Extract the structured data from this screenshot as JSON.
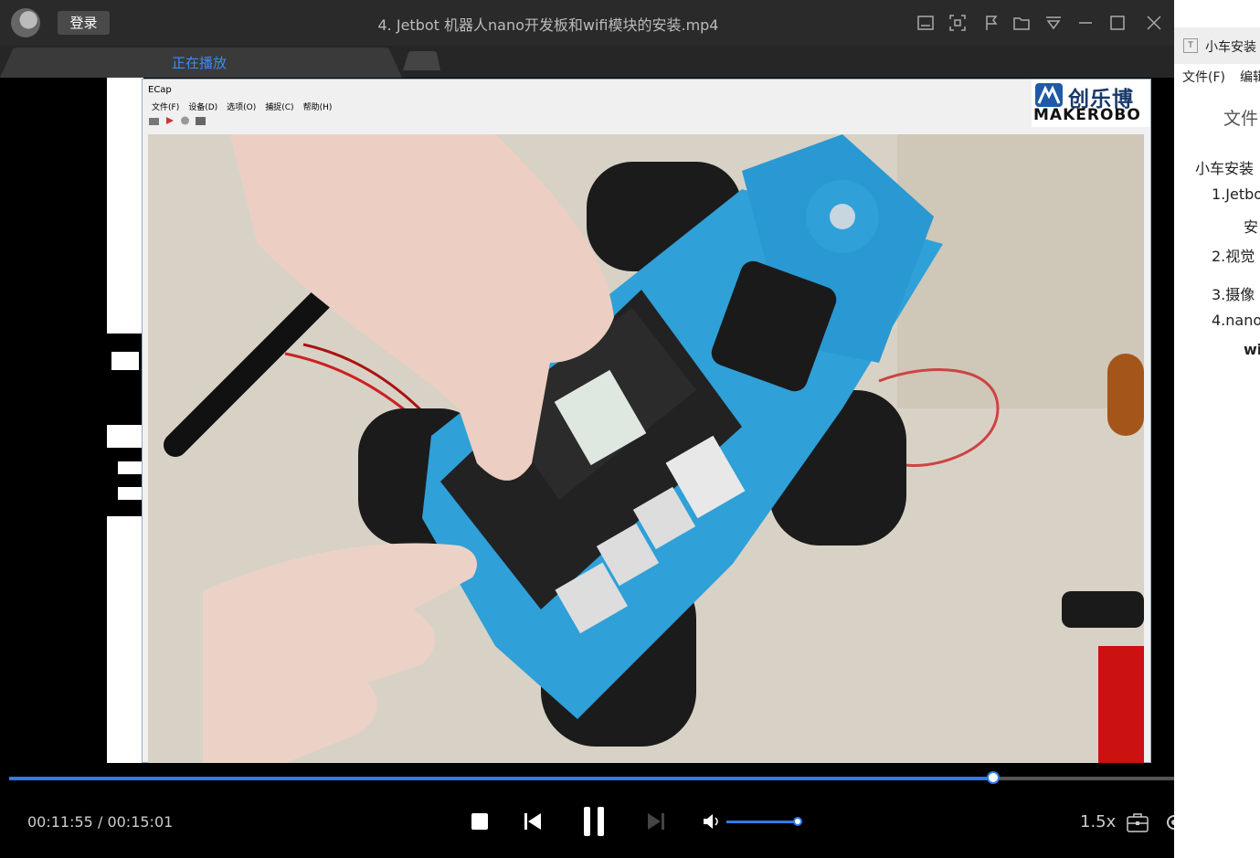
{
  "app": {
    "login_label": "登录",
    "window_title": "4. Jetbot 机器人nano开发板和wifi模块的安装.mp4",
    "tab_label": "正在播放"
  },
  "video_frame": {
    "window_title": "ECap",
    "menu": [
      "文件(F)",
      "设备(D)",
      "选项(O)",
      "捕捉(C)",
      "帮助(H)"
    ],
    "brand_cn": "创乐博",
    "brand_en": "MAKEROBO"
  },
  "player": {
    "current_time": "00:11:55",
    "separator": "/",
    "total_time": "00:15:01",
    "progress": 0.845,
    "volume": 1.0,
    "speed_label": "1.5x"
  },
  "sidebar": {
    "doc_tab": "小车安装",
    "menu_file": "文件(F)",
    "menu_edit": "编辑",
    "heading": "文件",
    "outline": [
      "小车安装",
      "1.Jetbo",
      "安",
      "2.视觉",
      "3.摄像",
      "4.nano",
      "wi"
    ]
  },
  "colors": {
    "accent": "#2f7be8",
    "tab_text": "#3b8cf0",
    "titlebar": "#2a2a2a"
  }
}
